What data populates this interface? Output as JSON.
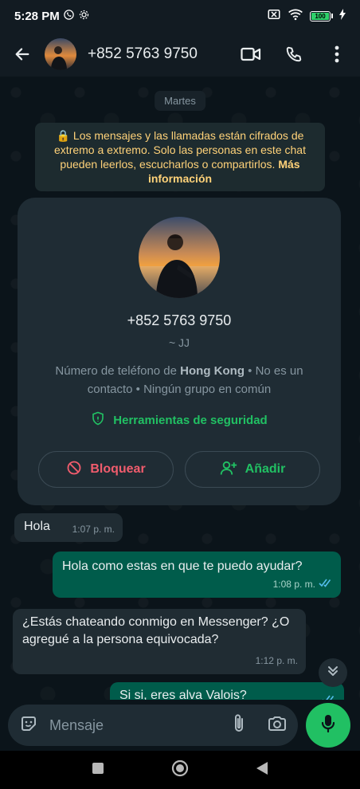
{
  "status_bar": {
    "time": "5:28 PM",
    "battery": "100"
  },
  "header": {
    "contact": "+852 5763 9750"
  },
  "chat": {
    "day_chip": "Martes",
    "encryption_notice": "🔒 Los mensajes y las llamadas están cifrados de extremo a extremo. Solo las personas en este chat pueden leerlos, escucharlos o compartirlos.",
    "encryption_link": "Más información"
  },
  "contact_card": {
    "phone": "+852 5763 9750",
    "nickname": "~ JJ",
    "info_prefix": "Número de teléfono de ",
    "info_country": "Hong Kong",
    "info_suffix": " • No es un contacto • Ningún grupo en común",
    "safety_tools": "Herramientas de seguridad",
    "block_label": "Bloquear",
    "add_label": "Añadir"
  },
  "messages": [
    {
      "direction": "in",
      "text": "Hola",
      "time": "1:07 p. m."
    },
    {
      "direction": "out",
      "text": "Hola como estas en que te puedo ayudar?",
      "time": "1:08 p. m."
    },
    {
      "direction": "in",
      "text": "¿Estás chateando conmigo en Messenger? ¿O agregué a la persona equivocada?",
      "time": "1:12 p. m."
    },
    {
      "direction": "out",
      "text": "Si si, eres alva Valois?",
      "time": ""
    }
  ],
  "composer": {
    "placeholder": "Mensaje"
  },
  "colors": {
    "accent": "#21c063",
    "danger": "#f15c6d",
    "outgoing": "#005c4b",
    "incoming": "#202c33",
    "background": "#0b141a"
  }
}
